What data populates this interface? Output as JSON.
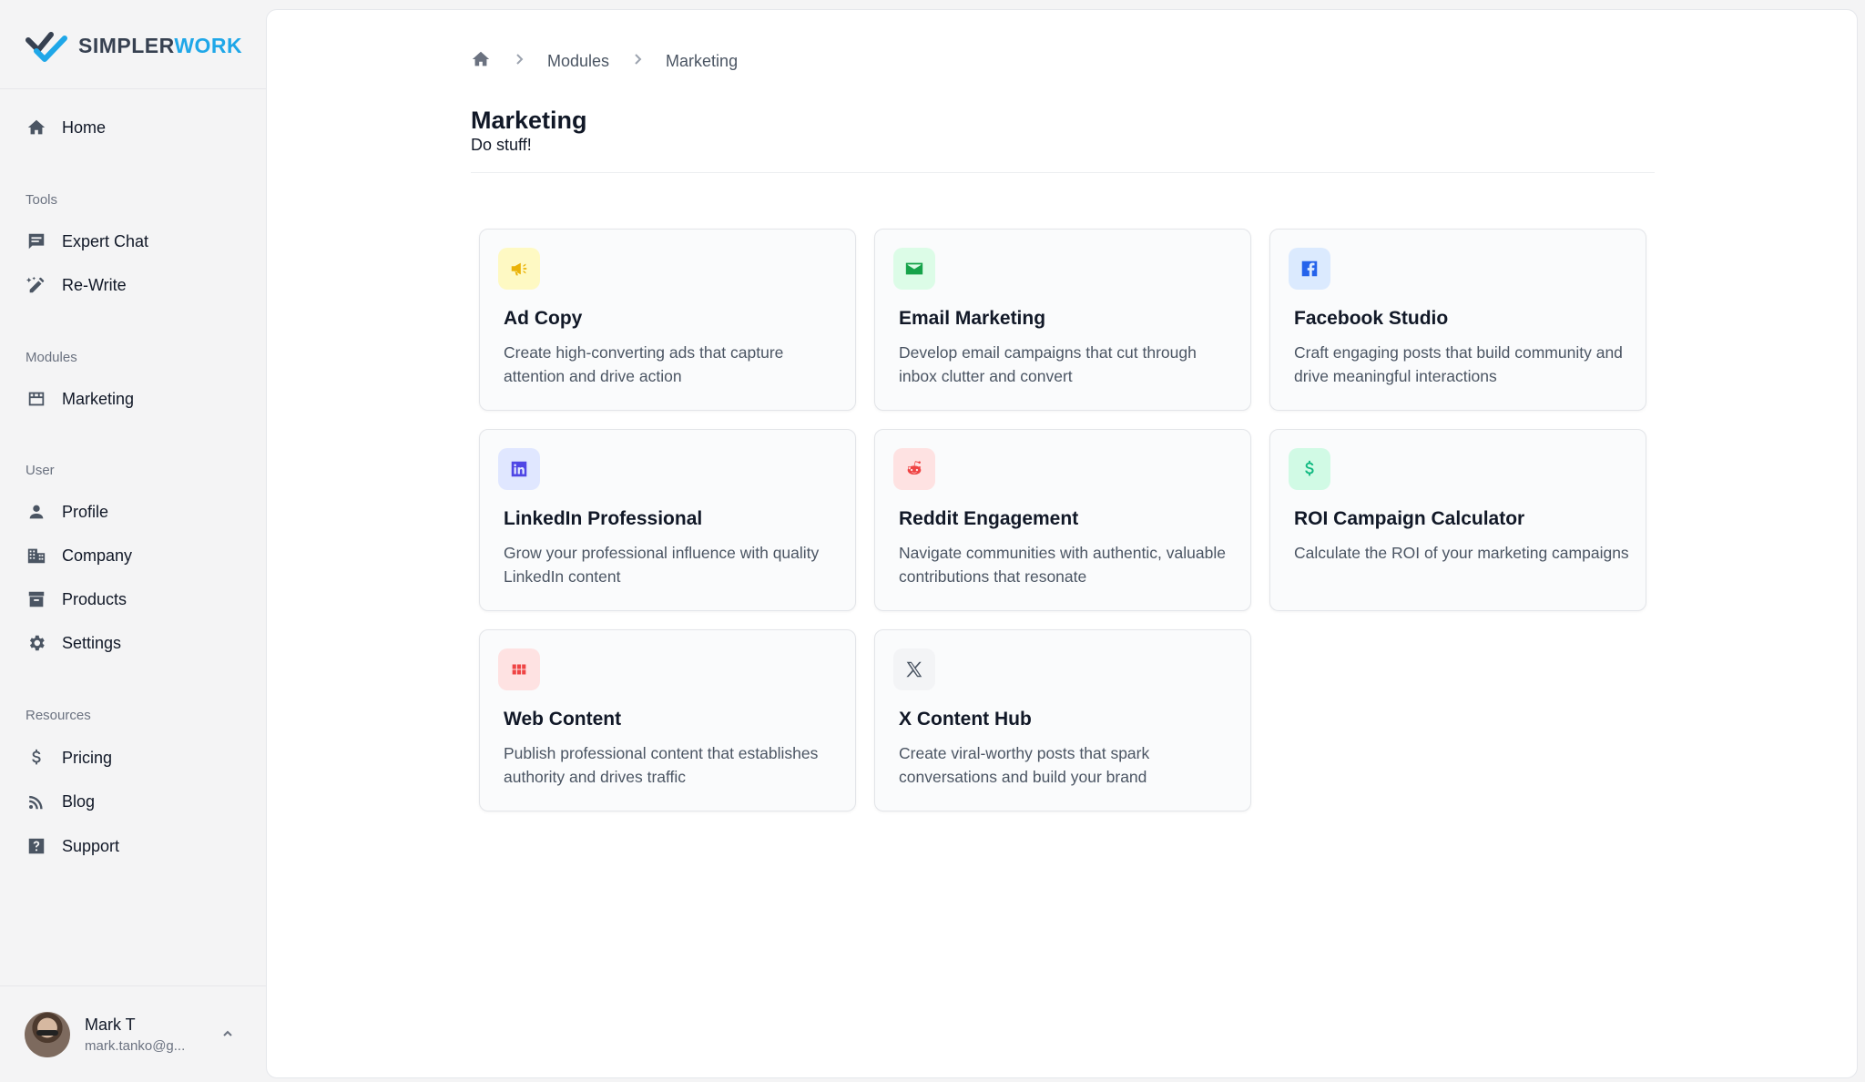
{
  "brand": {
    "name_part1": "SIMPLER",
    "name_part2": "WORK",
    "color_dark": "#374151",
    "color_accent": "#1fa7e8"
  },
  "sidebar": {
    "home": {
      "label": "Home",
      "icon": "home-icon"
    },
    "sections": {
      "tools": "Tools",
      "modules": "Modules",
      "user": "User",
      "resources": "Resources"
    },
    "tools": [
      {
        "label": "Expert Chat",
        "icon": "chat-icon"
      },
      {
        "label": "Re-Write",
        "icon": "edit-sparkle-icon"
      }
    ],
    "modules": [
      {
        "label": "Marketing",
        "icon": "storefront-icon"
      }
    ],
    "user_items": [
      {
        "label": "Profile",
        "icon": "person-icon"
      },
      {
        "label": "Company",
        "icon": "building-icon"
      },
      {
        "label": "Products",
        "icon": "archive-icon"
      },
      {
        "label": "Settings",
        "icon": "gear-icon"
      }
    ],
    "resources": [
      {
        "label": "Pricing",
        "icon": "dollar-icon"
      },
      {
        "label": "Blog",
        "icon": "rss-icon"
      },
      {
        "label": "Support",
        "icon": "help-icon"
      }
    ],
    "user": {
      "name": "Mark T",
      "email": "mark.tanko@g..."
    }
  },
  "breadcrumb": {
    "items": [
      "Modules",
      "Marketing"
    ]
  },
  "page": {
    "title": "Marketing",
    "subtitle": "Do stuff!"
  },
  "cards": [
    {
      "title": "Ad Copy",
      "desc": "Create high-converting ads that capture attention and drive action",
      "icon": "megaphone-icon",
      "bg": "#fef9c3",
      "fg": "#eab308"
    },
    {
      "title": "Email Marketing",
      "desc": "Develop email campaigns that cut through inbox clutter and convert",
      "icon": "envelope-icon",
      "bg": "#dcfce7",
      "fg": "#16a34a"
    },
    {
      "title": "Facebook Studio",
      "desc": "Craft engaging posts that build community and drive meaningful interactions",
      "icon": "facebook-icon",
      "bg": "#dbeafe",
      "fg": "#2563eb"
    },
    {
      "title": "LinkedIn Professional",
      "desc": "Grow your professional influence with quality LinkedIn content",
      "icon": "linkedin-icon",
      "bg": "#e0e7ff",
      "fg": "#4f46e5"
    },
    {
      "title": "Reddit Engagement",
      "desc": "Navigate communities with authentic, valuable contributions that resonate",
      "icon": "reddit-icon",
      "bg": "#fee2e2",
      "fg": "#ef4444"
    },
    {
      "title": "ROI Campaign Calculator",
      "desc": "Calculate the ROI of your marketing campaigns",
      "icon": "dollar-icon",
      "bg": "#d1fae5",
      "fg": "#10b981"
    },
    {
      "title": "Web Content",
      "desc": "Publish professional content that establishes authority and drives traffic",
      "icon": "grid-icon",
      "bg": "#fee2e2",
      "fg": "#ef4444"
    },
    {
      "title": "X Content Hub",
      "desc": "Create viral-worthy posts that spark conversations and build your brand",
      "icon": "x-logo-icon",
      "bg": "#f3f4f6",
      "fg": "#4b5563"
    }
  ]
}
